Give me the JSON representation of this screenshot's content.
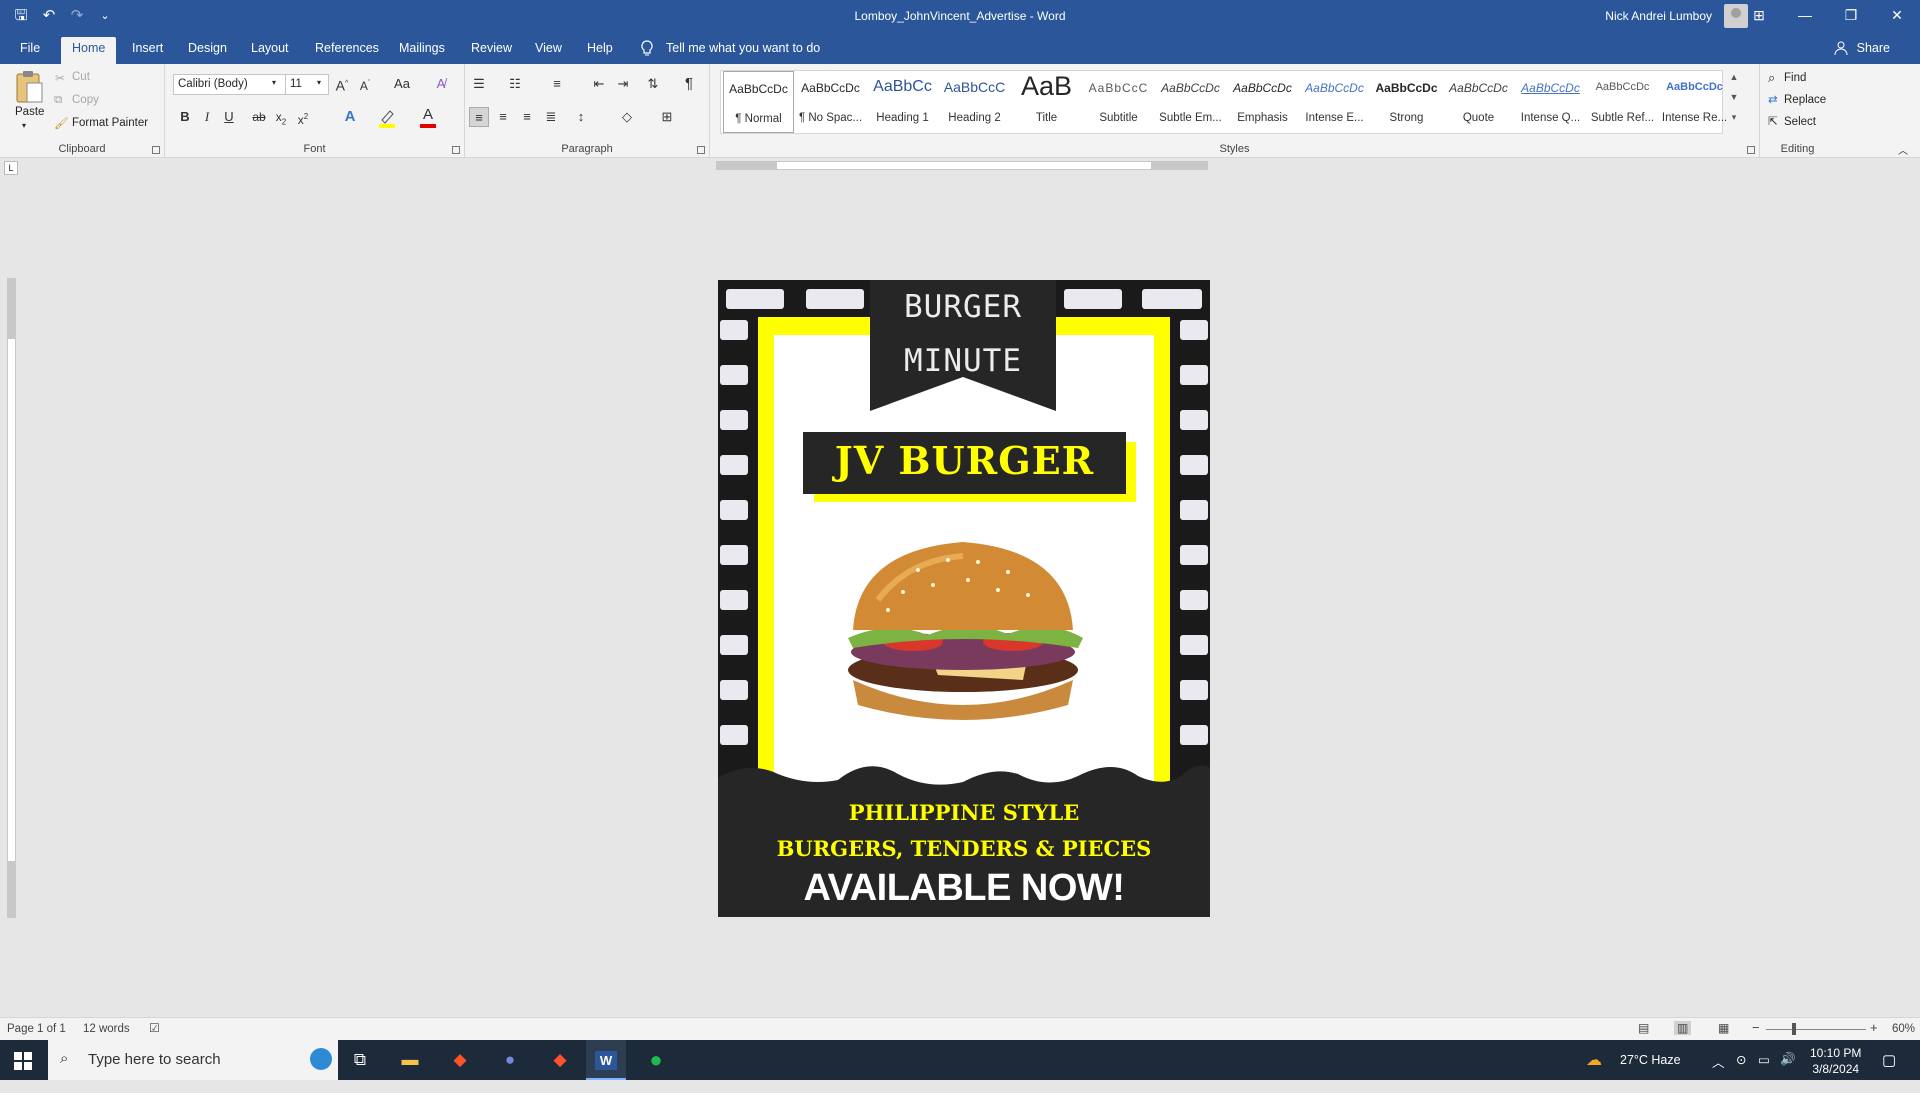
{
  "window": {
    "title": "Lomboy_JohnVincent_Advertise - Word",
    "user": "Nick Andrei Lumboy",
    "controls": {
      "ribbon_display": "⊞",
      "minimize": "—",
      "restore": "❐",
      "close": "✕"
    }
  },
  "qat": {
    "save": "🖫",
    "undo": "↶",
    "redo": "↷",
    "customize": "⌄"
  },
  "tabs": [
    "File",
    "Home",
    "Insert",
    "Design",
    "Layout",
    "References",
    "Mailings",
    "Review",
    "View",
    "Help"
  ],
  "active_tab": "Home",
  "tell_me": "Tell me what you want to do",
  "share": "Share",
  "clipboard": {
    "paste": "Paste",
    "cut": "Cut",
    "copy": "Copy",
    "format_painter": "Format Painter",
    "label": "Clipboard"
  },
  "font": {
    "name": "Calibri (Body)",
    "size": "11",
    "label": "Font",
    "case": "Aa"
  },
  "paragraph": {
    "label": "Paragraph"
  },
  "styles": {
    "label": "Styles",
    "items": [
      {
        "preview": "AaBbCcDc",
        "name": "¶ Normal"
      },
      {
        "preview": "AaBbCcDc",
        "name": "¶ No Spac..."
      },
      {
        "preview": "AaBbCc",
        "name": "Heading 1"
      },
      {
        "preview": "AaBbCcC",
        "name": "Heading 2"
      },
      {
        "preview": "AaB",
        "name": "Title"
      },
      {
        "preview": "AaBbCcC",
        "name": "Subtitle"
      },
      {
        "preview": "AaBbCcDc",
        "name": "Subtle Em..."
      },
      {
        "preview": "AaBbCcDc",
        "name": "Emphasis"
      },
      {
        "preview": "AaBbCcDc",
        "name": "Intense E..."
      },
      {
        "preview": "AaBbCcDc",
        "name": "Strong"
      },
      {
        "preview": "AaBbCcDc",
        "name": "Quote"
      },
      {
        "preview": "AaBbCcDc",
        "name": "Intense Q..."
      },
      {
        "preview": "AaBbCcDc",
        "name": "Subtle Ref..."
      },
      {
        "preview": "AaBbCcDc",
        "name": "Intense Re..."
      }
    ]
  },
  "editing": {
    "find": "Find",
    "replace": "Replace",
    "select": "Select",
    "label": "Editing"
  },
  "flyer": {
    "banner_line1": "BURGER",
    "banner_line2": "MINUTE",
    "headline": "JV BURGER",
    "line1": "PHILIPPINE STYLE",
    "line2": "BURGERS, TENDERS & PIECES",
    "line3": "AVAILABLE NOW!"
  },
  "status": {
    "page": "Page 1 of 1",
    "words": "12 words",
    "zoom": "60%"
  },
  "taskbar": {
    "search_placeholder": "Type here to search",
    "weather": "27°C  Haze",
    "time": "10:10 PM",
    "date": "3/8/2024"
  },
  "colors": {
    "accent": "#2b579a",
    "flyer_yellow": "#ffff00",
    "flyer_dark": "#262626"
  }
}
